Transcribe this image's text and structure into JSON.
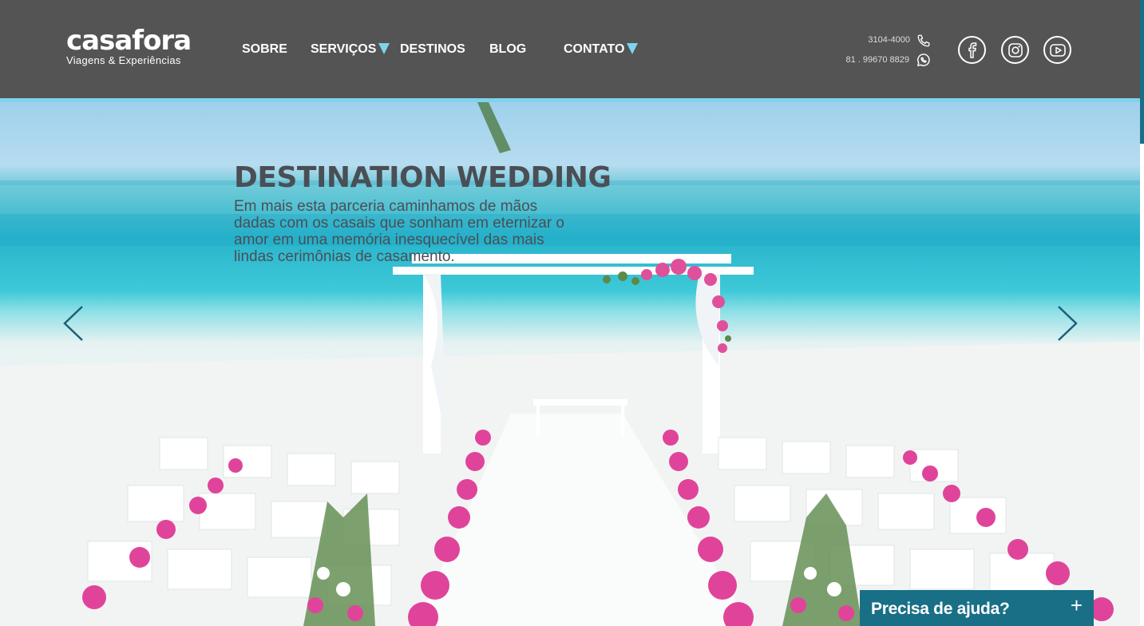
{
  "brand": {
    "name": "casafora",
    "tagline": "Viagens & Experiências"
  },
  "nav": [
    {
      "label": "SOBRE",
      "has_dropdown": false
    },
    {
      "label": "SERVIÇOS",
      "has_dropdown": true
    },
    {
      "label": "DESTINOS",
      "has_dropdown": false
    },
    {
      "label": "BLOG",
      "has_dropdown": false
    },
    {
      "label": "CONTATO",
      "has_dropdown": true
    }
  ],
  "contact": {
    "phone": "3104-4000",
    "whatsapp": "81 . 99670 8829"
  },
  "social": [
    "facebook-icon",
    "instagram-icon",
    "youtube-icon"
  ],
  "hero": {
    "title": "DESTINATION WEDDING",
    "text": "Em mais esta parceria caminhamos de mãos dadas com os casais que sonham em eternizar o amor em uma memória inesquecível das mais lindas cerimônias de casamento."
  },
  "help": {
    "label": "Precisa de ajuda?",
    "plus": "+"
  },
  "colors": {
    "header_bg": "#545454",
    "accent": "#7fd3ec",
    "help_bg": "#186f86"
  }
}
